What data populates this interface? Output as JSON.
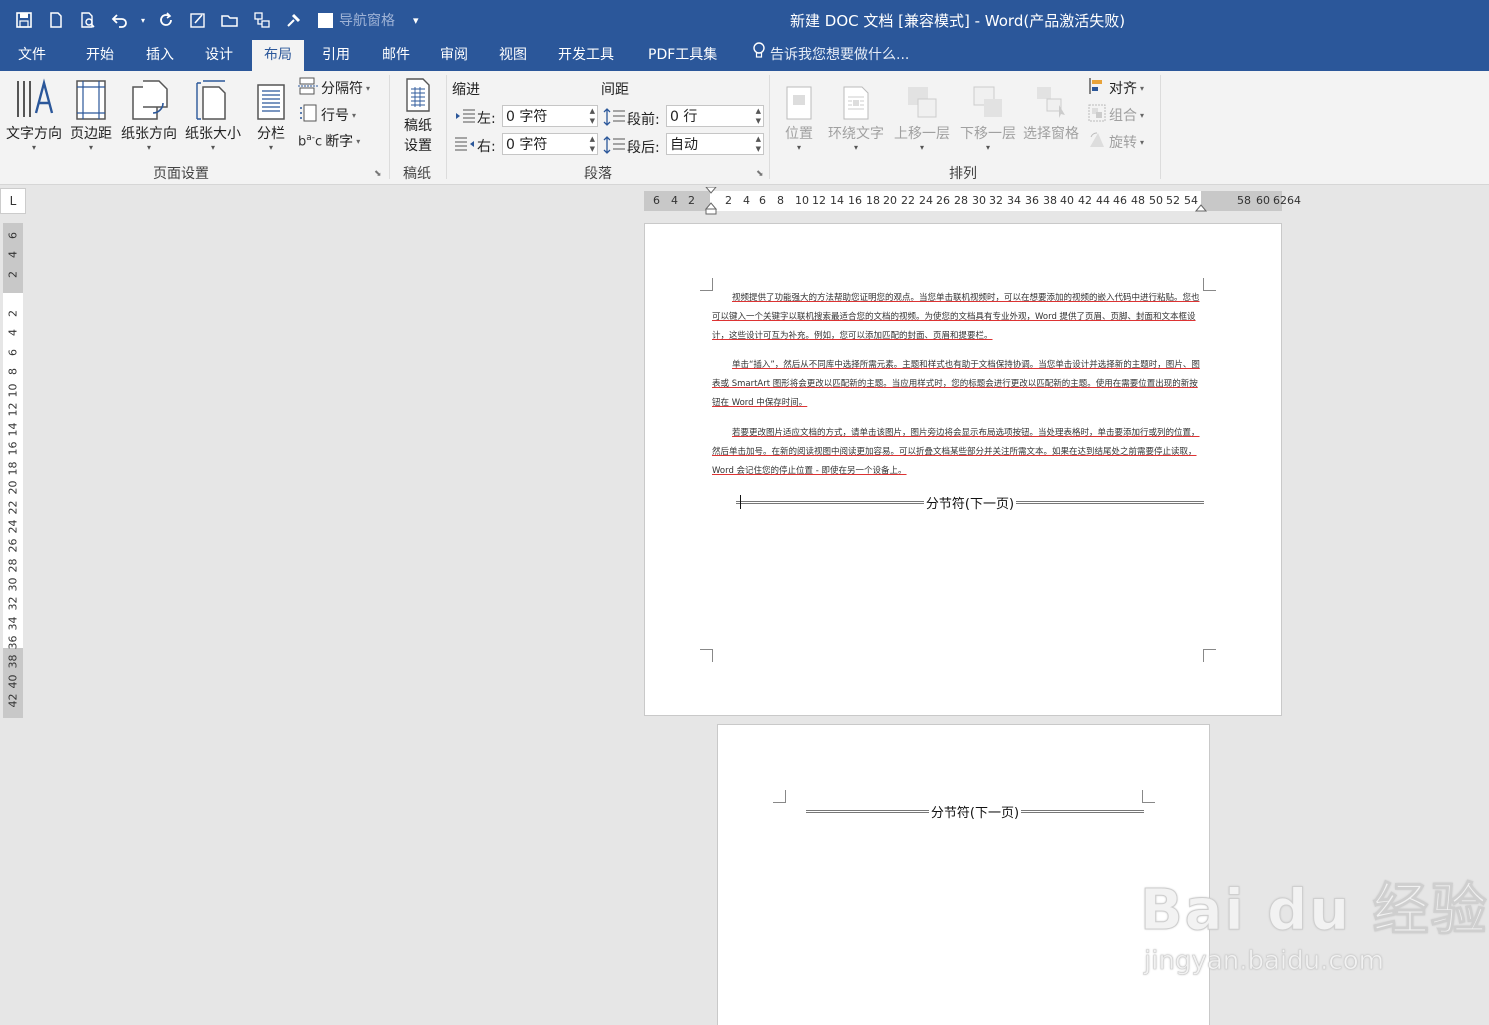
{
  "window": {
    "title": "新建 DOC 文档 [兼容模式] - Word(产品激活失败)",
    "nav_pane_label": "导航窗格"
  },
  "tabs": [
    {
      "label": "文件"
    },
    {
      "label": "开始"
    },
    {
      "label": "插入"
    },
    {
      "label": "设计"
    },
    {
      "label": "布局"
    },
    {
      "label": "引用"
    },
    {
      "label": "邮件"
    },
    {
      "label": "审阅"
    },
    {
      "label": "视图"
    },
    {
      "label": "开发工具"
    },
    {
      "label": "PDF工具集"
    }
  ],
  "active_tab": "布局",
  "tell_me": "告诉我您想要做什么...",
  "ribbon": {
    "page_setup": {
      "group_label": "页面设置",
      "text_direction": "文字方向",
      "margins": "页边距",
      "orientation": "纸张方向",
      "size": "纸张大小",
      "columns": "分栏",
      "breaks": "分隔符",
      "line_numbers": "行号",
      "hyphenation": "断字"
    },
    "manuscript": {
      "group_label": "稿纸",
      "setup_line1": "稿纸",
      "setup_line2": "设置"
    },
    "paragraph": {
      "group_label": "段落",
      "indent_title": "缩进",
      "spacing_title": "间距",
      "left_label": "左:",
      "left_value": "0 字符",
      "right_label": "右:",
      "right_value": "0 字符",
      "before_label": "段前:",
      "before_value": "0 行",
      "after_label": "段后:",
      "after_value": "自动"
    },
    "arrange": {
      "group_label": "排列",
      "position": "位置",
      "wrap_text": "环绕文字",
      "bring_forward": "上移一层",
      "send_backward": "下移一层",
      "selection_pane": "选择窗格",
      "align": "对齐",
      "group": "组合",
      "rotate": "旋转"
    }
  },
  "hruler_ticks": [
    "6",
    "4",
    "2",
    "2",
    "4",
    "6",
    "8",
    "10",
    "12",
    "14",
    "16",
    "18",
    "20",
    "22",
    "24",
    "26",
    "28",
    "30",
    "32",
    "34",
    "36",
    "38",
    "40",
    "42",
    "44",
    "46",
    "48",
    "50",
    "52",
    "54",
    "58",
    "60",
    "62",
    "64"
  ],
  "vruler_ticks": [
    "6",
    "4",
    "2",
    "2",
    "4",
    "6",
    "8",
    "10",
    "12",
    "14",
    "16",
    "18",
    "20",
    "22",
    "24",
    "26",
    "28",
    "30",
    "32",
    "34",
    "36",
    "38",
    "40",
    "42"
  ],
  "ruler_corner": "L",
  "document": {
    "paragraphs": [
      "视频提供了功能强大的方法帮助您证明您的观点。当您单击联机视频时，可以在想要添加的视频的嵌入代码中进行粘贴。您也可以键入一个关键字以联机搜索最适合您的文档的视频。为使您的文档具有专业外观，Word 提供了页眉、页脚、封面和文本框设计，这些设计可互为补充。例如，您可以添加匹配的封面、页眉和提要栏。",
      "单击“插入”，然后从不同库中选择所需元素。主题和样式也有助于文档保持协调。当您单击设计并选择新的主题时，图片、图表或 SmartArt 图形将会更改以匹配新的主题。当应用样式时，您的标题会进行更改以匹配新的主题。使用在需要位置出现的新按钮在 Word 中保存时间。",
      "若要更改图片适应文档的方式，请单击该图片，图片旁边将会显示布局选项按钮。当处理表格时，单击要添加行或列的位置，然后单击加号。在新的阅读视图中阅读更加容易。可以折叠文档某些部分并关注所需文本。如果在达到结尾处之前需要停止读取，Word 会记住您的停止位置 - 即使在另一个设备上。"
    ],
    "section_break_1": "分节符(下一页)",
    "section_break_2": "分节符(下一页)"
  },
  "watermark": {
    "brand": "Bai du 经验",
    "url": "jingyan.baidu.com"
  }
}
